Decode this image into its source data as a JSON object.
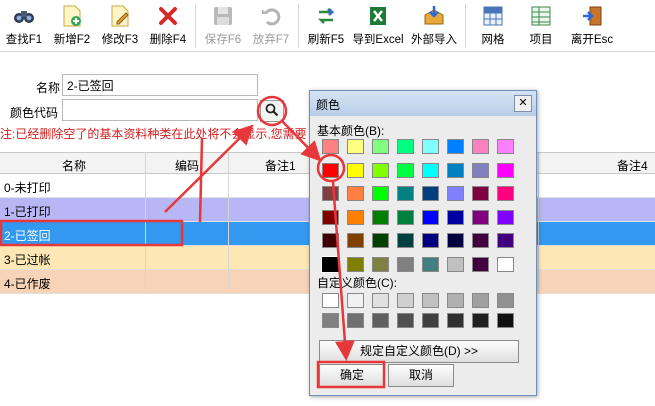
{
  "toolbar": {
    "items": [
      {
        "label": "查找F1",
        "icon": "binoculars-icon",
        "disabled": false
      },
      {
        "label": "新增F2",
        "icon": "new-document-icon",
        "disabled": false
      },
      {
        "label": "修改F3",
        "icon": "edit-document-icon",
        "disabled": false
      },
      {
        "label": "删除F4",
        "icon": "delete-x-icon",
        "disabled": false
      },
      {
        "label": "保存F6",
        "icon": "floppy-disk-icon",
        "disabled": true
      },
      {
        "label": "放弃F7",
        "icon": "undo-icon",
        "disabled": true
      },
      {
        "label": "刷新F5",
        "icon": "refresh-icon",
        "disabled": false
      },
      {
        "label": "导到Excel",
        "icon": "excel-icon",
        "disabled": false
      },
      {
        "label": "外部导入",
        "icon": "import-box-icon",
        "disabled": false
      },
      {
        "label": "网格",
        "icon": "grid-icon",
        "disabled": false
      },
      {
        "label": "项目",
        "icon": "spreadsheet-icon",
        "disabled": false
      },
      {
        "label": "离开Esc",
        "icon": "exit-door-icon",
        "disabled": false
      }
    ]
  },
  "form": {
    "name_label": "名称",
    "name_value": "2-已签回",
    "color_label": "颜色代码",
    "color_value": ""
  },
  "note": "注:已经删除空了的基本资料种类在此处将不会显示,您需要",
  "grid": {
    "columns": [
      "名称",
      "编码",
      "备注1",
      "备注4"
    ],
    "rows": [
      {
        "name": "0-未打印",
        "color": "#ffffff"
      },
      {
        "name": "1-已打印",
        "color": "#b7b7f5"
      },
      {
        "name": "2-已签回",
        "color": "#3399f0",
        "selected": true
      },
      {
        "name": "3-已过帐",
        "color": "#fde8b5"
      },
      {
        "name": "4-已作废",
        "color": "#f7d3b7"
      }
    ]
  },
  "dialog": {
    "title": "颜色",
    "close": "✕",
    "basic_label": "基本颜色(B):",
    "custom_label": "自定义颜色(C):",
    "define_custom": "规定自定义颜色(D) >>",
    "ok": "确定",
    "cancel": "取消",
    "basic_colors": [
      [
        "#ff8080",
        "#ffff80",
        "#80ff80",
        "#00ff80",
        "#80ffff",
        "#0080ff",
        "#ff80c0",
        "#ff80ff"
      ],
      [
        "#ff0000",
        "#ffff00",
        "#80ff00",
        "#00ff40",
        "#00ffff",
        "#0080c0",
        "#8080c0",
        "#ff00ff"
      ],
      [
        "#804040",
        "#ff8040",
        "#00ff00",
        "#008080",
        "#004080",
        "#8080ff",
        "#800040",
        "#ff0080"
      ],
      [
        "#800000",
        "#ff8000",
        "#008000",
        "#008040",
        "#0000ff",
        "#0000a0",
        "#800080",
        "#8000ff"
      ],
      [
        "#400000",
        "#804000",
        "#004000",
        "#004040",
        "#000080",
        "#000040",
        "#400040",
        "#400080"
      ],
      [
        "#000000",
        "#808000",
        "#808040",
        "#808080",
        "#408080",
        "#c0c0c0",
        "#400040",
        "#ffffff"
      ]
    ],
    "custom_colors": [
      [
        "#ffffff",
        "#f0f0f0",
        "#e0e0e0",
        "#d0d0d0",
        "#c0c0c0",
        "#b0b0b0",
        "#a0a0a0",
        "#909090"
      ],
      [
        "#808080",
        "#707070",
        "#606060",
        "#505050",
        "#404040",
        "#303030",
        "#202020",
        "#101010"
      ]
    ]
  },
  "colors": {
    "annotation": "#e8373a",
    "selected_row": "#3399f0",
    "note_text": "#d01c1c"
  }
}
